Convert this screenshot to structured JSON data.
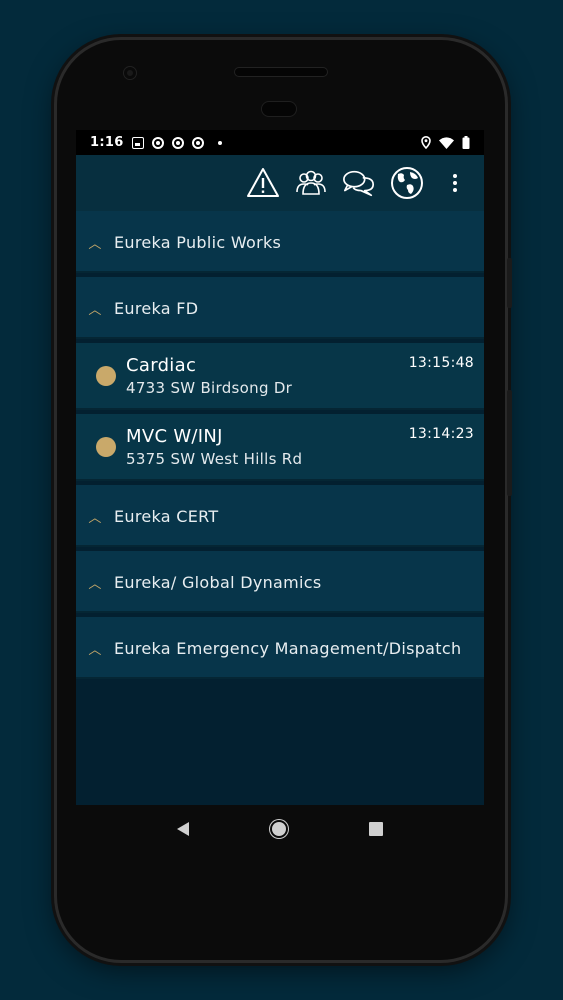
{
  "status_bar": {
    "time": "1:16"
  },
  "toolbar": {
    "icons": [
      "warning-icon",
      "users-group-icon",
      "chat-bubbles-icon",
      "globe-icon",
      "more-vert-icon"
    ]
  },
  "groups_top": [
    {
      "label": "Eureka Public Works"
    },
    {
      "label": "Eureka FD"
    }
  ],
  "incidents": [
    {
      "title": "Cardiac",
      "address": "4733 SW Birdsong Dr",
      "time": "13:15:48"
    },
    {
      "title": "MVC W/INJ",
      "address": "5375 SW West Hills Rd",
      "time": "13:14:23"
    }
  ],
  "groups_bottom": [
    {
      "label": "Eureka CERT"
    },
    {
      "label": "Eureka/ Global Dynamics"
    },
    {
      "label": "Eureka Emergency Management/Dispatch"
    }
  ],
  "colors": {
    "background": "#032a3b",
    "row": "#07354a",
    "accent": "#c9a96a"
  }
}
